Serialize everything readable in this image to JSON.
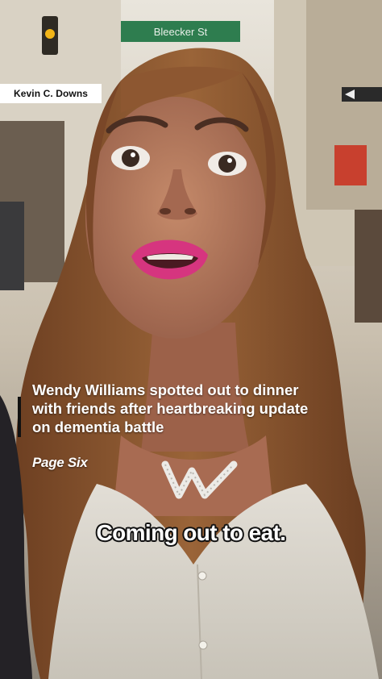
{
  "credit": {
    "text": "Kevin C. Downs"
  },
  "street_sign": {
    "text": "Bleecker St"
  },
  "headline": {
    "text": "Wendy Williams spotted out to dinner with friends after heartbreaking update on dementia battle"
  },
  "source": {
    "text": "Page Six"
  },
  "caption": {
    "text": "Coming out to eat."
  },
  "colors": {
    "hair": "#8a5530",
    "skin": "#b07558",
    "lips": "#d6357f",
    "shirt": "#d8d4cb",
    "sky": "#ede9e1"
  }
}
